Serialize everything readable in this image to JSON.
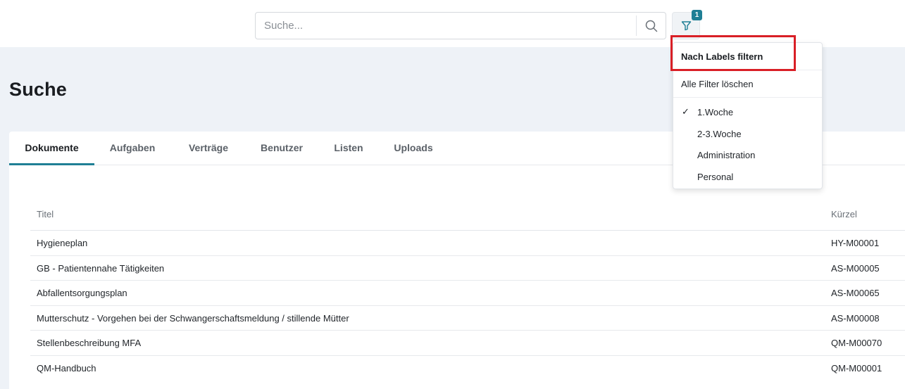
{
  "search": {
    "placeholder": "Suche..."
  },
  "filter": {
    "badge_count": "1",
    "accent_color": "#1f7f95"
  },
  "page": {
    "title": "Suche"
  },
  "tabs": [
    {
      "label": "Dokumente",
      "active": true
    },
    {
      "label": "Aufgaben",
      "active": false
    },
    {
      "label": "Verträge",
      "active": false
    },
    {
      "label": "Benutzer",
      "active": false
    },
    {
      "label": "Listen",
      "active": false
    },
    {
      "label": "Uploads",
      "active": false
    }
  ],
  "table": {
    "columns": [
      "Titel",
      "Kürzel"
    ],
    "rows": [
      [
        "Hygieneplan",
        "HY-M00001"
      ],
      [
        "GB - Patientennahe Tätigkeiten",
        "AS-M00005"
      ],
      [
        "Abfallentsorgungsplan",
        "AS-M00065"
      ],
      [
        "Mutterschutz - Vorgehen bei der Schwangerschaftsmeldung / stillende Mütter",
        "AS-M00008"
      ],
      [
        "Stellenbeschreibung MFA",
        "QM-M00070"
      ],
      [
        "QM-Handbuch",
        "QM-M00001"
      ]
    ]
  },
  "dropdown": {
    "header": "Nach Labels filtern",
    "clear": "Alle Filter löschen",
    "check_glyph": "✓",
    "items": [
      {
        "label": "1.Woche",
        "checked": true
      },
      {
        "label": "2-3.Woche",
        "checked": false
      },
      {
        "label": "Administration",
        "checked": false
      },
      {
        "label": "Personal",
        "checked": false
      }
    ]
  }
}
